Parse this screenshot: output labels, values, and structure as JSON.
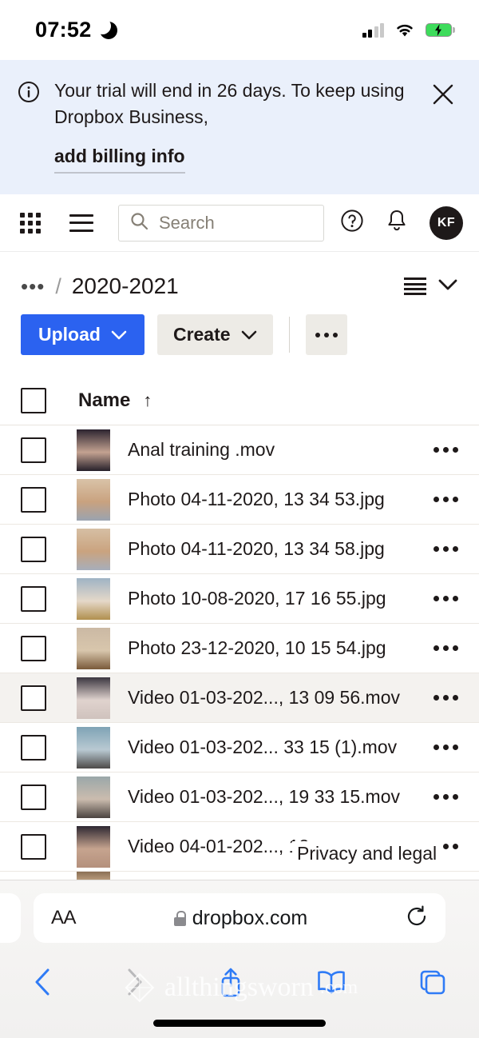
{
  "status_bar": {
    "time": "07:52",
    "dnd_icon": "moon-icon",
    "signal_icon": "cellular-signal-icon",
    "wifi_icon": "wifi-icon",
    "battery_icon": "battery-charging-icon"
  },
  "banner": {
    "info_icon": "info-circle-icon",
    "message": "Your trial will end in 26 days. To keep using Dropbox Business,",
    "link": "add billing info",
    "close_icon": "close-icon",
    "background": "#eaf0fb"
  },
  "navbar": {
    "apps_icon": "grid-apps-icon",
    "menu_icon": "hamburger-menu-icon",
    "search_placeholder": "Search",
    "search_icon": "search-icon",
    "help_icon": "help-circle-icon",
    "notifications_icon": "bell-icon",
    "avatar_initials": "KF"
  },
  "breadcrumb": {
    "ellipsis": "•••",
    "separator": "/",
    "current": "2020-2021",
    "view_icon": "list-view-icon",
    "chevron_icon": "chevron-down-icon"
  },
  "toolbar": {
    "upload_label": "Upload",
    "create_label": "Create",
    "more_icon": "overflow-dots-icon",
    "upload_color": "#2b62f0",
    "create_color": "#edebe6"
  },
  "table": {
    "header": {
      "name": "Name",
      "sort_arrow": "↑"
    },
    "rows": [
      {
        "name": "Anal training .mov",
        "highlight": false,
        "thumb": [
          "#2c2430",
          "#c3a291",
          "#26202a"
        ]
      },
      {
        "name": "Photo 04-11-2020, 13 34 53.jpg",
        "highlight": false,
        "thumb": [
          "#d9c3a8",
          "#c9a27f",
          "#9aa3b0"
        ]
      },
      {
        "name": "Photo 04-11-2020, 13 34 58.jpg",
        "highlight": false,
        "thumb": [
          "#d6bfa4",
          "#caa37f",
          "#a7aebb"
        ]
      },
      {
        "name": "Photo 10-08-2020, 17 16 55.jpg",
        "highlight": false,
        "thumb": [
          "#9fb3c4",
          "#e5d8c9",
          "#b08f4e"
        ]
      },
      {
        "name": "Photo 23-12-2020, 10 15 54.jpg",
        "highlight": false,
        "thumb": [
          "#cbb9a4",
          "#d8c6ac",
          "#7a5a3a"
        ]
      },
      {
        "name": "Video 01-03-202..., 13 09 56.mov",
        "highlight": true,
        "thumb": [
          "#3b3640",
          "#e0d3ce",
          "#cfc2bd"
        ]
      },
      {
        "name": "Video 01-03-202... 33 15 (1).mov",
        "highlight": false,
        "thumb": [
          "#7fa3b5",
          "#b9c9d2",
          "#4d4a48"
        ]
      },
      {
        "name": "Video 01-03-202..., 19 33 15.mov",
        "highlight": false,
        "thumb": [
          "#9aa7a9",
          "#cbbcae",
          "#4a4340"
        ]
      },
      {
        "name": "Video 04-01-202..., 12",
        "highlight": false,
        "thumb": [
          "#2e2832",
          "#c6a48f",
          "#b4907c"
        ]
      }
    ],
    "partial_row_thumb": [
      "#8a6f55",
      "#c9ab8a",
      "#6d5640"
    ],
    "row_more_icon": "overflow-dots-icon",
    "checkbox_name": "row-checkbox"
  },
  "footer": {
    "privacy_link": "Privacy and legal"
  },
  "safari": {
    "text_size_label": "AA",
    "lock_icon": "lock-icon",
    "url": "dropbox.com",
    "reload_icon": "reload-icon",
    "back_icon": "back-chevron-icon",
    "forward_icon": "forward-chevron-icon",
    "share_icon": "share-icon",
    "bookmarks_icon": "book-icon",
    "tabs_icon": "tabs-icon",
    "back_enabled_color": "#2f7bf6",
    "forward_disabled_color": "#b9b9bb"
  },
  "watermark": {
    "text": "allthingsworn",
    "suffix": ".com"
  }
}
